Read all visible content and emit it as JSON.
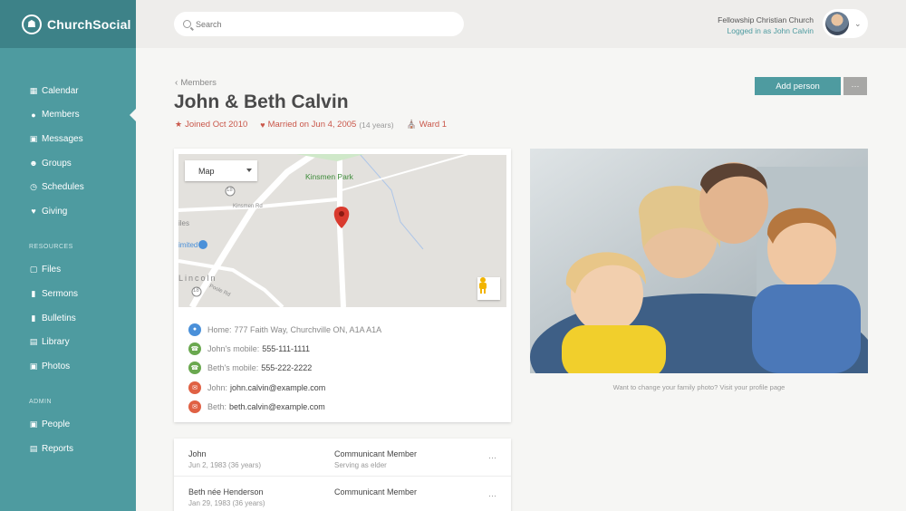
{
  "brand": {
    "name": "ChurchSocial"
  },
  "sidebar": {
    "items": [
      {
        "label": "Calendar",
        "icon": "calendar-icon"
      },
      {
        "label": "Members",
        "icon": "user-icon",
        "active": true
      },
      {
        "label": "Messages",
        "icon": "messages-icon"
      },
      {
        "label": "Groups",
        "icon": "groups-icon"
      },
      {
        "label": "Schedules",
        "icon": "clock-icon"
      },
      {
        "label": "Giving",
        "icon": "heart-icon"
      }
    ],
    "resources_heading": "RESOURCES",
    "resources": [
      {
        "label": "Files",
        "icon": "file-icon"
      },
      {
        "label": "Sermons",
        "icon": "microphone-icon"
      },
      {
        "label": "Bulletins",
        "icon": "bulletin-icon"
      },
      {
        "label": "Library",
        "icon": "book-icon"
      },
      {
        "label": "Photos",
        "icon": "photo-icon"
      }
    ],
    "admin_heading": "ADMIN",
    "admin": [
      {
        "label": "People",
        "icon": "person-card-icon"
      },
      {
        "label": "Reports",
        "icon": "printer-icon"
      }
    ]
  },
  "topbar": {
    "search_placeholder": "Search",
    "church": "Fellowship Christian Church",
    "logged_in": "Logged in as John Calvin"
  },
  "page": {
    "breadcrumb": "Members",
    "title": "John & Beth Calvin",
    "joined": "Joined Oct 2010",
    "married": "Married on Jun 4, 2005",
    "married_years": "(14 years)",
    "ward": "Ward 1",
    "add_person": "Add person",
    "more": "···"
  },
  "map": {
    "type_select": "Map",
    "park_label": "Kinsmen Park",
    "road_label": "Kinsmen Rd",
    "road_label_2": "Poole Rd",
    "town_label": "Lincoln",
    "place_1": "iles",
    "place_2": "imited",
    "route_1": "18",
    "route_2": "18"
  },
  "contacts": [
    {
      "label": "Home:",
      "value": "777 Faith Way, Churchville ON, A1A A1A",
      "color": "#4a90d9",
      "icon": "location-icon"
    },
    {
      "label": "John's mobile:",
      "value": "555-111-1111",
      "color": "#6aa84f",
      "icon": "phone-icon"
    },
    {
      "label": "Beth's mobile:",
      "value": "555-222-2222",
      "color": "#6aa84f",
      "icon": "phone-icon"
    },
    {
      "label": "John:",
      "value": "john.calvin@example.com",
      "color": "#e06144",
      "icon": "email-icon"
    },
    {
      "label": "Beth:",
      "value": "beth.calvin@example.com",
      "color": "#e06144",
      "icon": "email-icon"
    }
  ],
  "photo_caption": "Want to change your family photo? Visit your profile page",
  "members": [
    {
      "name": "John",
      "dob": "Jun 2, 1983 (36 years)",
      "role": "Communicant Member",
      "role_sub": "Serving as elder"
    },
    {
      "name": "Beth née Henderson",
      "dob": "Jan 29, 1983 (36 years)",
      "role": "Communicant Member",
      "role_sub": ""
    }
  ],
  "colors": {
    "accent": "#4e9ba0",
    "accent_dark": "#3d8288",
    "alert": "#c9574a"
  }
}
